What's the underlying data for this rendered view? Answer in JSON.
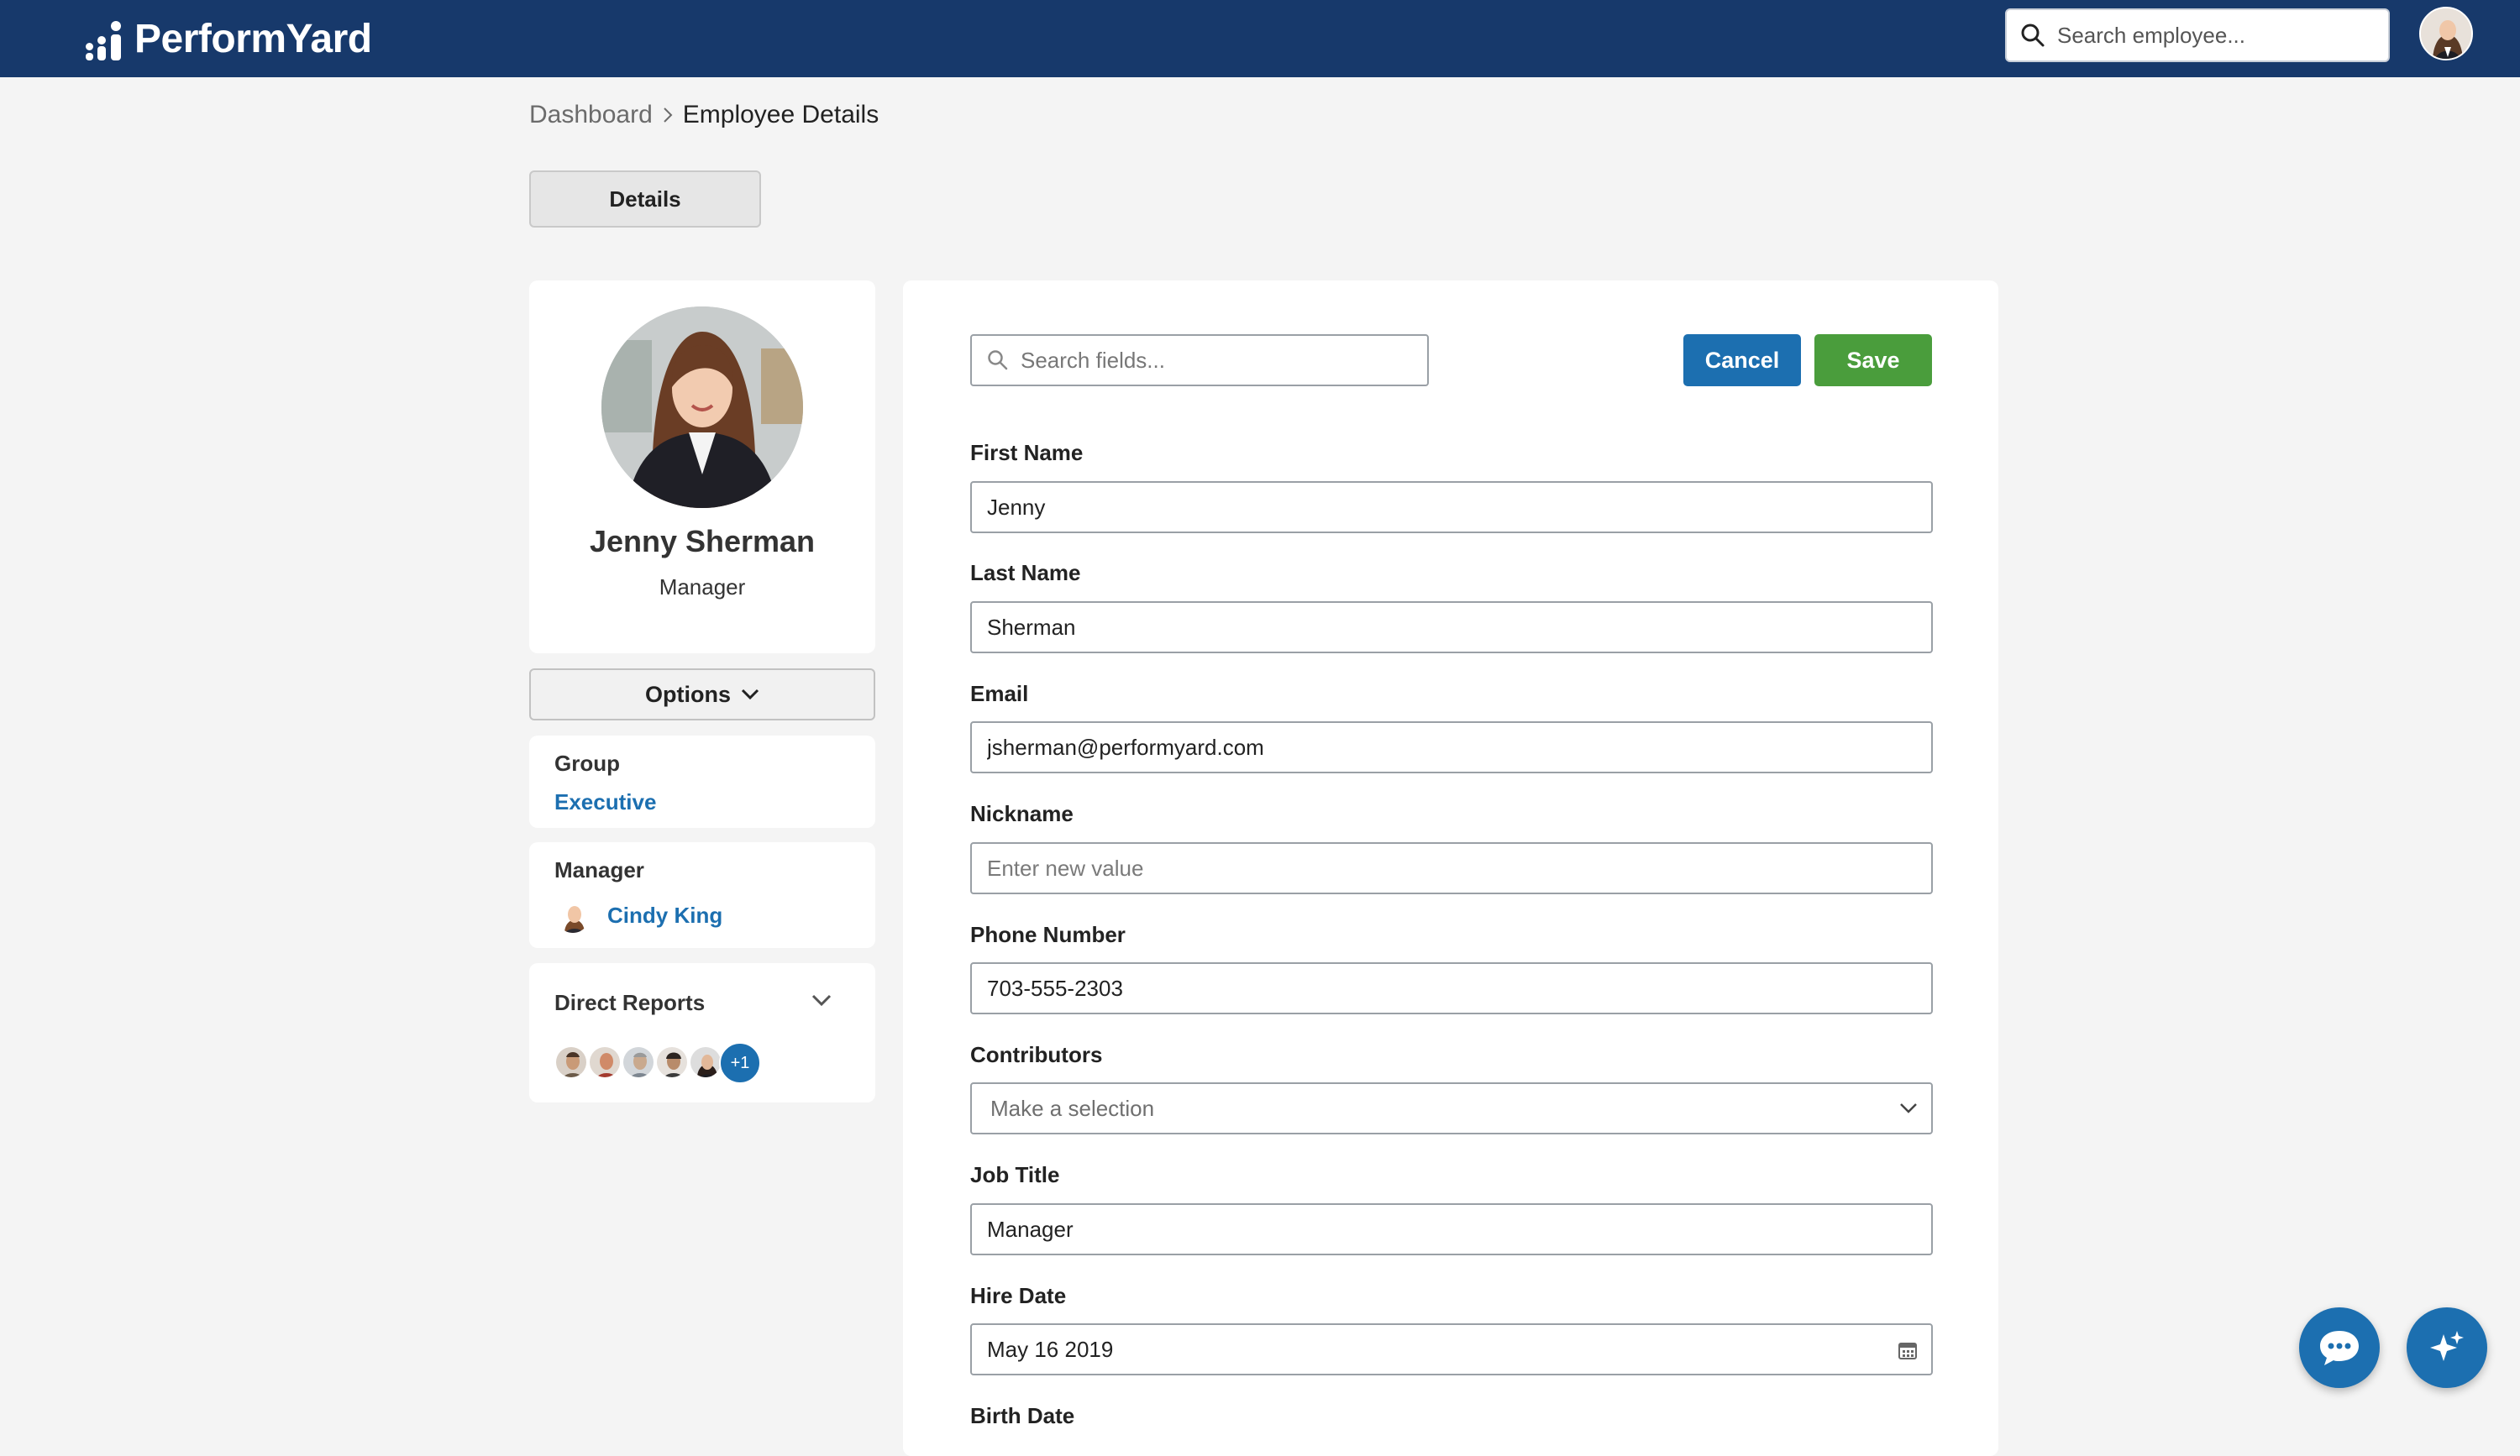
{
  "header": {
    "brand": "PerformYard",
    "search_placeholder": "Search employee...",
    "avatar_icon": "user-avatar-icon"
  },
  "breadcrumb": {
    "items": [
      "Dashboard",
      "Employee Details"
    ]
  },
  "tabs": {
    "details_label": "Details"
  },
  "profile": {
    "name": "Jenny Sherman",
    "title": "Manager"
  },
  "sidebar": {
    "options_label": "Options",
    "group_label": "Group",
    "group_value": "Executive",
    "manager_label": "Manager",
    "manager_name": "Cindy King",
    "direct_reports_label": "Direct Reports",
    "direct_reports_more": "+1"
  },
  "form": {
    "search_placeholder": "Search fields...",
    "cancel_label": "Cancel",
    "save_label": "Save",
    "fields": {
      "first_name": {
        "label": "First Name",
        "value": "Jenny"
      },
      "last_name": {
        "label": "Last Name",
        "value": "Sherman"
      },
      "email": {
        "label": "Email",
        "value": "jsherman@performyard.com"
      },
      "nickname": {
        "label": "Nickname",
        "value": "",
        "placeholder": "Enter new value"
      },
      "phone": {
        "label": "Phone Number",
        "value": "703-555-2303"
      },
      "contributors": {
        "label": "Contributors",
        "placeholder": "Make a selection"
      },
      "job_title": {
        "label": "Job Title",
        "value": "Manager"
      },
      "hire_date": {
        "label": "Hire Date",
        "value": "May 16 2019"
      },
      "birth_date": {
        "label": "Birth Date"
      }
    }
  },
  "colors": {
    "header_bg": "#17396b",
    "primary": "#1c6fb0",
    "success": "#4a9d3c",
    "page_bg": "#f4f4f4"
  }
}
